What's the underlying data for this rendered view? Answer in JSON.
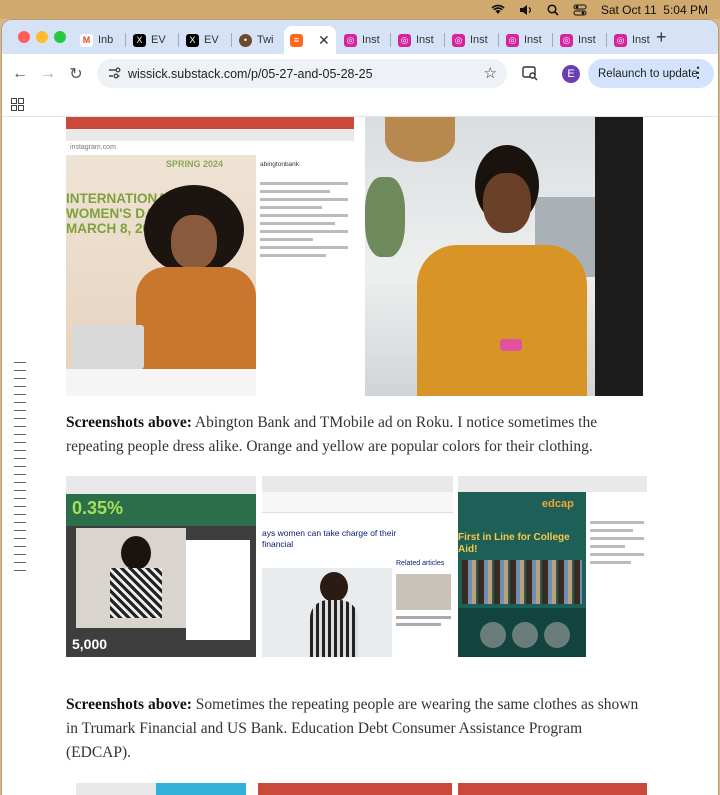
{
  "system": {
    "date_time": "Sat Oct 11  5:04 PM"
  },
  "tabs": [
    {
      "label": "Inb",
      "favicon": "gmail-icon",
      "color": "#ea4335",
      "glyph": "M"
    },
    {
      "label": "EV",
      "favicon": "x-icon",
      "color": "#000000",
      "glyph": "X"
    },
    {
      "label": "EV",
      "favicon": "x-icon",
      "color": "#000000",
      "glyph": "X"
    },
    {
      "label": "Twi",
      "favicon": "twitter-avatar-icon",
      "color": "#6b4b2a",
      "glyph": "•"
    },
    {
      "label": "",
      "favicon": "substack-icon",
      "color": "#ff6719",
      "glyph": "≡",
      "active": true
    },
    {
      "label": "Inst",
      "favicon": "instagram-icon",
      "color": "#d6249f",
      "glyph": "◎"
    },
    {
      "label": "Inst",
      "favicon": "instagram-icon",
      "color": "#d6249f",
      "glyph": "◎"
    },
    {
      "label": "Inst",
      "favicon": "instagram-icon",
      "color": "#d6249f",
      "glyph": "◎"
    },
    {
      "label": "Inst",
      "favicon": "instagram-icon",
      "color": "#d6249f",
      "glyph": "◎"
    },
    {
      "label": "Inst",
      "favicon": "instagram-icon",
      "color": "#d6249f",
      "glyph": "◎"
    },
    {
      "label": "Inst",
      "favicon": "instagram-icon",
      "color": "#d6249f",
      "glyph": "◎"
    }
  ],
  "toolbar": {
    "url": "wissick.substack.com/p/05-27-and-05-28-25",
    "relaunch_label": "Relaunch to update",
    "profile_initial": "E"
  },
  "article": {
    "image1": {
      "small_text": "abingtonbank",
      "banner_line1": "INTERNATIONAL",
      "banner_line2": "WOMEN'S DAY",
      "banner_line3": "MARCH 8, 2024",
      "banner_top": "SPRING 2024"
    },
    "caption1_bold": "Screenshots above:",
    "caption1_text": " Abington Bank and TMobile ad on Roku. I notice sometimes the repeating people dress alike. Orange and yellow are popular colors for their clothing.",
    "image3": {
      "top_text": "0.35%",
      "bottom_text": "5,000"
    },
    "image4": {
      "headline": "ays women can take charge of their financial",
      "side_title": "Related articles"
    },
    "image5": {
      "headline": "First in Line for College Aid!",
      "logo": "edcap"
    },
    "caption2_bold": "Screenshots above:",
    "caption2_text": " Sometimes the repeating people are wearing the same clothes as shown in Trumark Financial and US Bank. Education Debt Consumer Assistance Program (EDCAP)."
  }
}
